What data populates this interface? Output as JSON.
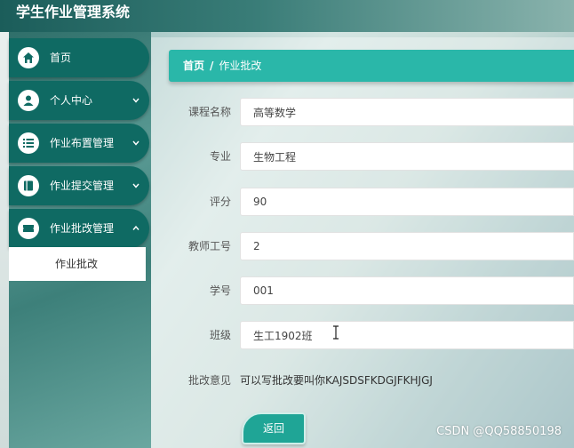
{
  "app": {
    "title": "学生作业管理系统"
  },
  "sidebar": {
    "items": [
      {
        "label": "首页",
        "icon": "home-icon"
      },
      {
        "label": "个人中心",
        "icon": "user-icon"
      },
      {
        "label": "作业布置管理",
        "icon": "list-icon"
      },
      {
        "label": "作业提交管理",
        "icon": "book-icon"
      },
      {
        "label": "作业批改管理",
        "icon": "ticket-icon"
      }
    ],
    "subitem": "作业批改"
  },
  "breadcrumb": {
    "home": "首页",
    "separator": "/",
    "current": "作业批改"
  },
  "form": {
    "course_label": "课程名称",
    "course_value": "高等数学",
    "major_label": "专业",
    "major_value": "生物工程",
    "score_label": "评分",
    "score_value": "90",
    "teacher_label": "教师工号",
    "teacher_value": "2",
    "student_label": "学号",
    "student_value": "001",
    "class_label": "班级",
    "class_value": "生工1902班",
    "remark_label": "批改意见",
    "remark_value": "可以写批改要叫你KAJSDSFKDGJFKHJGJ"
  },
  "actions": {
    "back_label": "返回"
  },
  "watermark": "CSDN @QQ58850198",
  "colors": {
    "accent": "#2ab7a9",
    "nav": "#0f6a63"
  }
}
